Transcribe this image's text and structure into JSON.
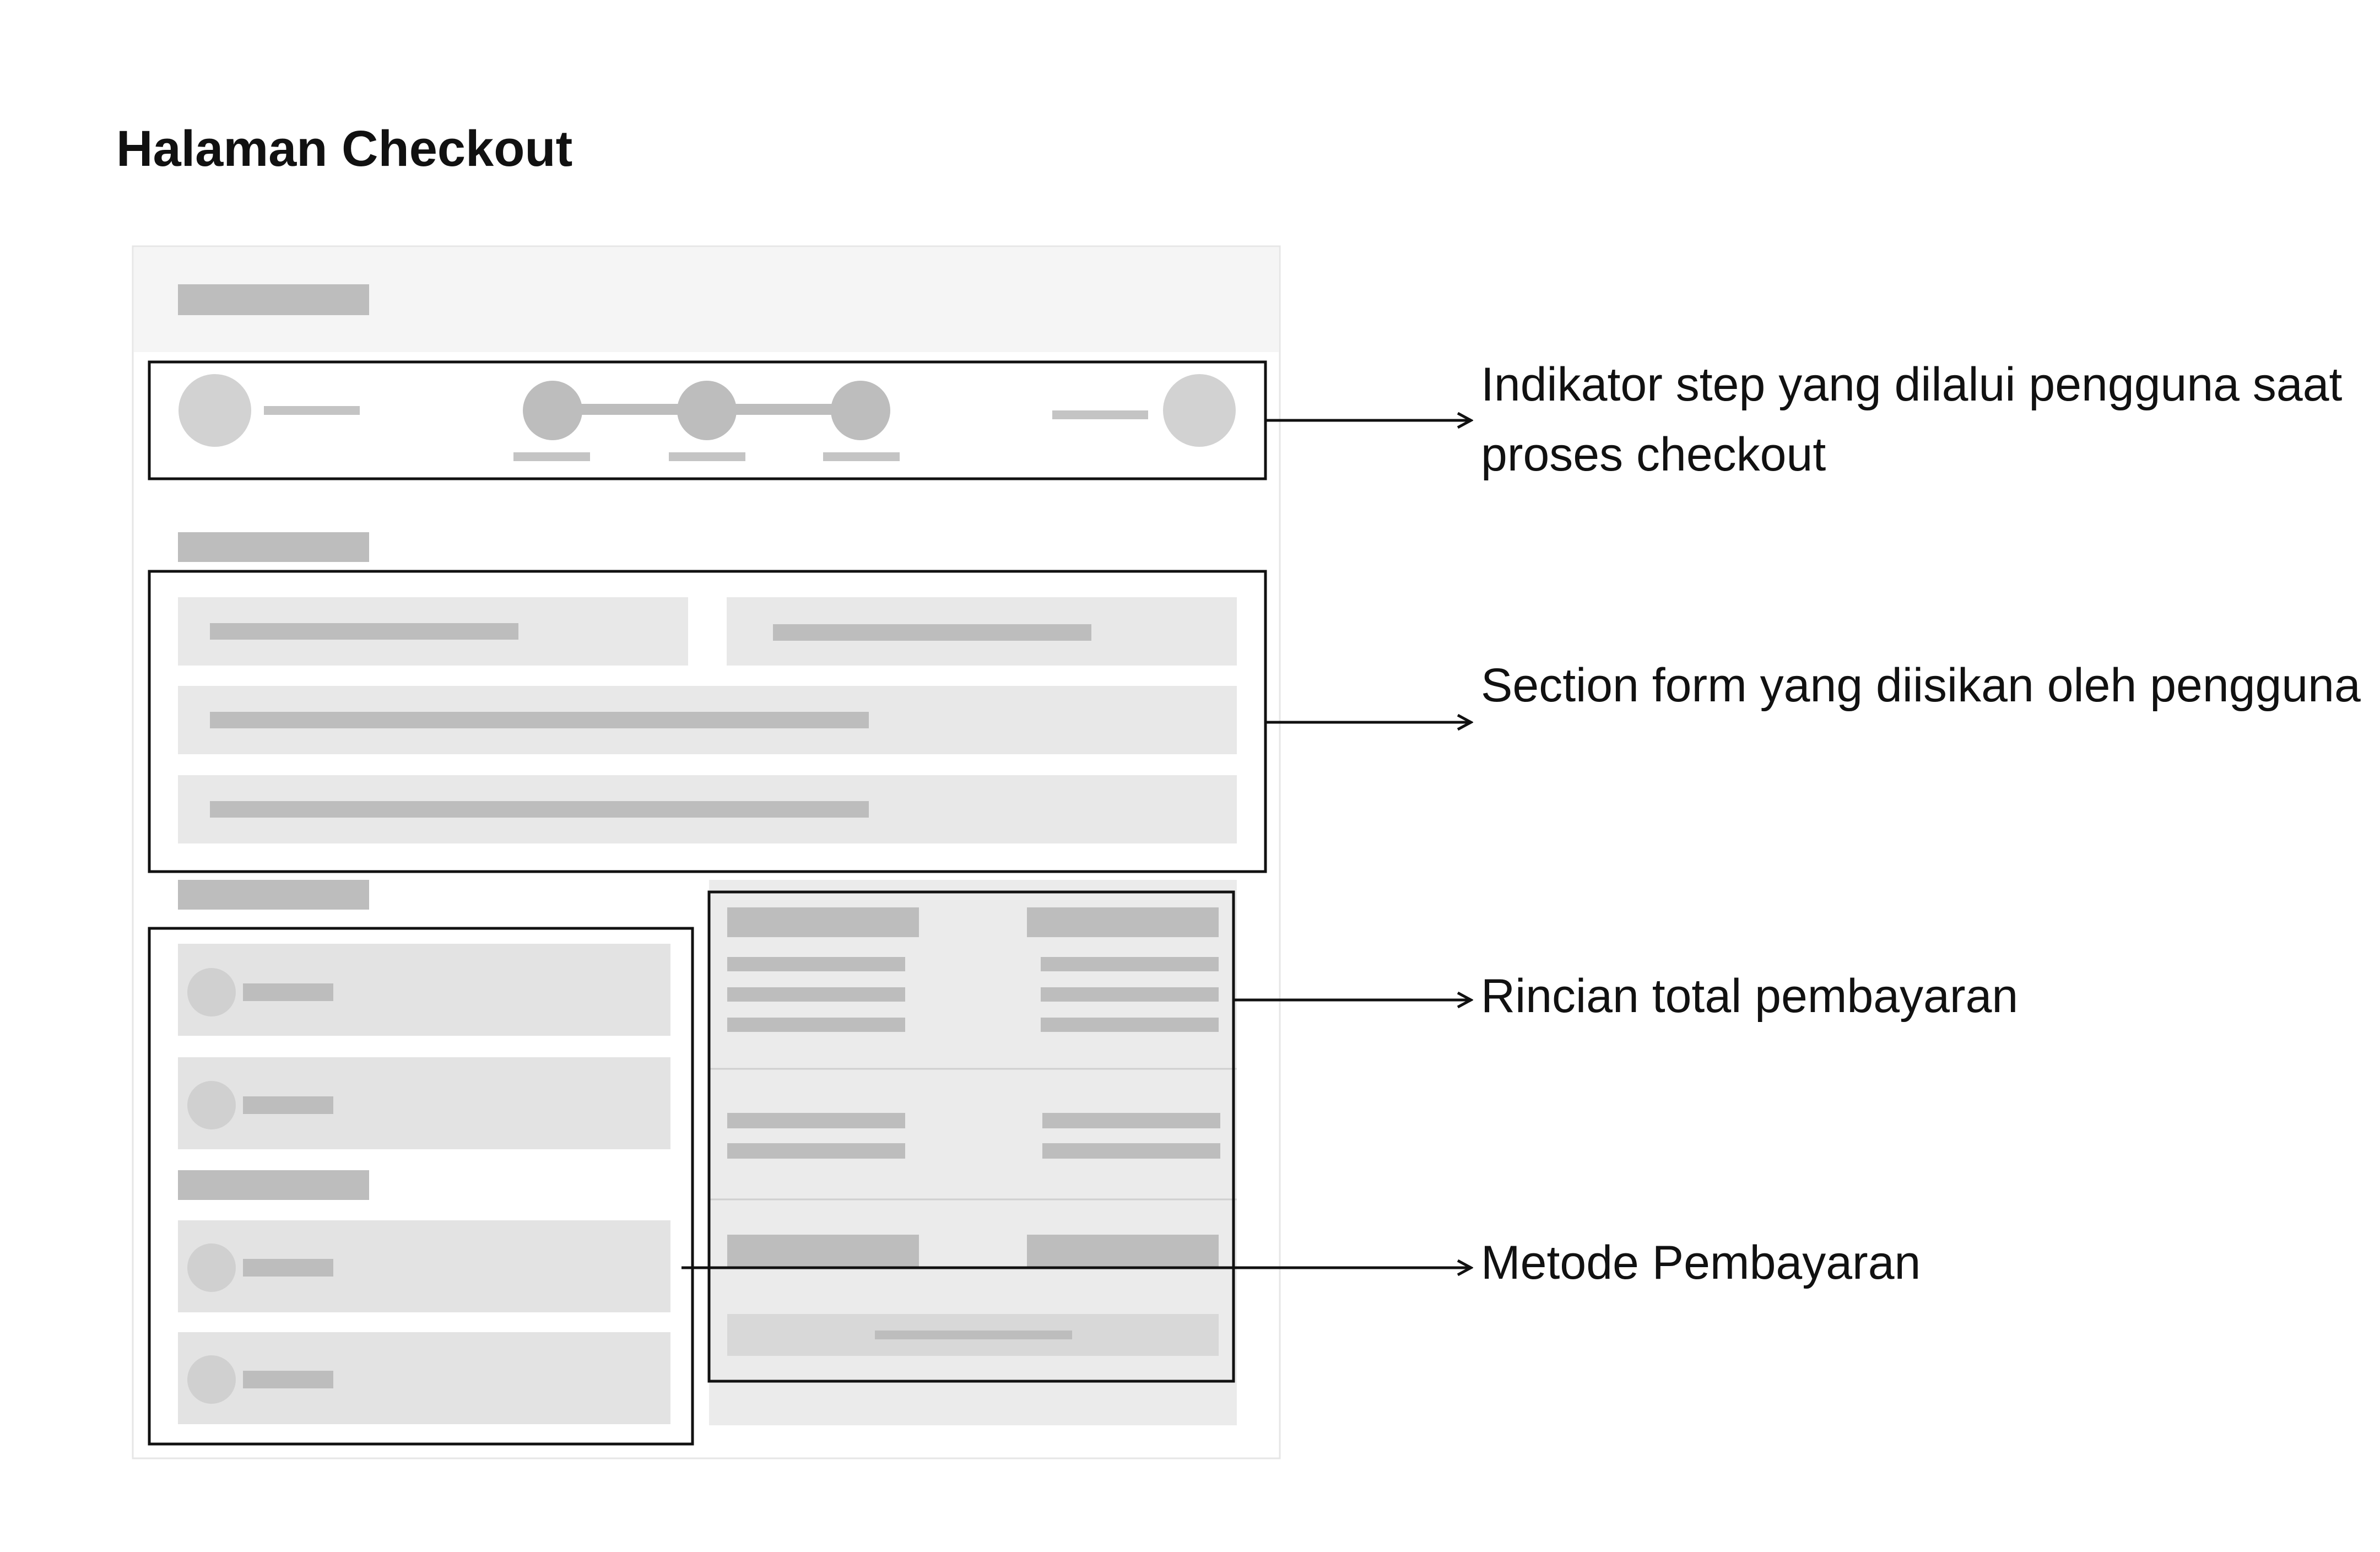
{
  "title": "Halaman Checkout",
  "annotations": {
    "step_indicator": "Indikator step yang dilalui pengguna saat proses checkout",
    "form_section": "Section form yang diisikan oleh pengguna",
    "payment_summary": "Rincian total pembayaran",
    "payment_method": "Metode Pembayaran"
  },
  "colors": {
    "frame_bg": "#f7f7f7",
    "placeholder_dark": "#bdbdbd",
    "placeholder_light": "#e8e8e8",
    "circle": "#d2d2d2",
    "outline": "#111111"
  }
}
